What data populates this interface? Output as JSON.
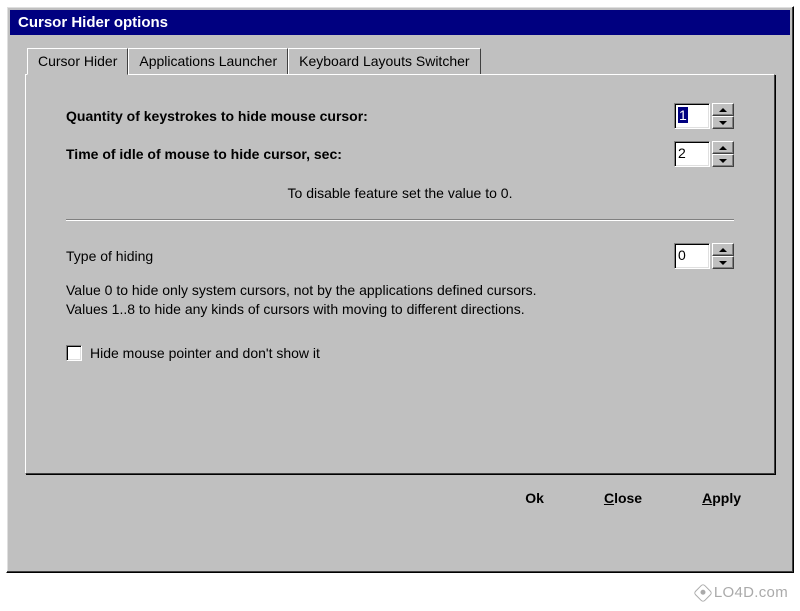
{
  "window": {
    "title": "Cursor Hider options"
  },
  "tabs": [
    {
      "label": "Cursor Hider"
    },
    {
      "label": "Applications Launcher"
    },
    {
      "label": "Keyboard Layouts Switcher"
    }
  ],
  "panel": {
    "keystrokes": {
      "label": "Quantity of keystrokes to hide mouse cursor:",
      "value": "1"
    },
    "idle": {
      "label": "Time of idle of mouse to hide cursor, sec:",
      "value": "2"
    },
    "disable_hint": "To disable feature set the value to 0.",
    "hiding_type": {
      "label": "Type of hiding",
      "value": "0"
    },
    "desc_line1": "Value 0 to hide only system cursors, not by the applications defined cursors.",
    "desc_line2": "Values 1..8 to hide any kinds of cursors with moving to different directions.",
    "hide_checkbox_label": "Hide mouse pointer and don't show it"
  },
  "buttons": {
    "ok": "Ok",
    "close_pre": "C",
    "close_rest": "lose",
    "apply_pre": "A",
    "apply_rest": "pply"
  },
  "watermark": "LO4D.com"
}
